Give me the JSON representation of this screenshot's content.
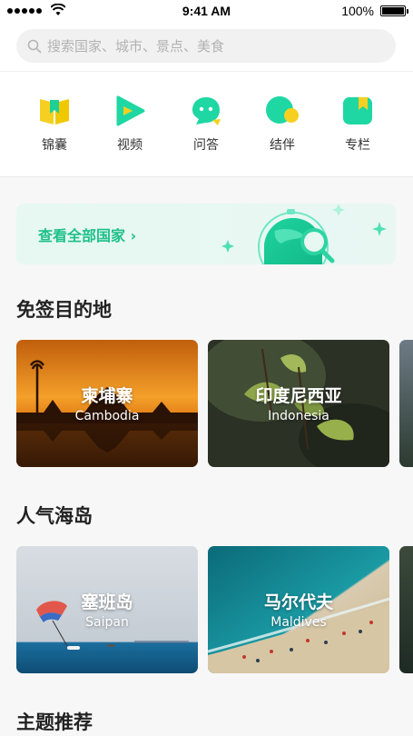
{
  "status_bar": {
    "time": "9:41 AM",
    "battery": "100%"
  },
  "search": {
    "placeholder": "搜索国家、城市、景点、美食"
  },
  "categories": [
    {
      "label": "锦囊",
      "icon": "book-icon",
      "color": "#f5d020"
    },
    {
      "label": "视频",
      "icon": "play-icon",
      "color": "#20d8a8"
    },
    {
      "label": "问答",
      "icon": "chat-bubble-icon",
      "color": "#20d8a8"
    },
    {
      "label": "结伴",
      "icon": "companion-icon",
      "color": "#20d8a8"
    },
    {
      "label": "专栏",
      "icon": "bookmark-column-icon",
      "color": "#20d8a8"
    }
  ],
  "banner": {
    "label": "查看全部国家 ›"
  },
  "sections": {
    "visa_free": {
      "title": "免签目的地",
      "cards": [
        {
          "title": "柬埔寨",
          "subtitle": "Cambodia"
        },
        {
          "title": "印度尼西亚",
          "subtitle": "Indonesia"
        }
      ]
    },
    "islands": {
      "title": "人气海岛",
      "cards": [
        {
          "title": "塞班岛",
          "subtitle": "Saipan"
        },
        {
          "title": "马尔代夫",
          "subtitle": "Maldives"
        }
      ]
    },
    "themes": {
      "title": "主题推荐"
    }
  },
  "colors": {
    "accent": "#1ec08a",
    "page_bg": "#f7f7f7"
  }
}
